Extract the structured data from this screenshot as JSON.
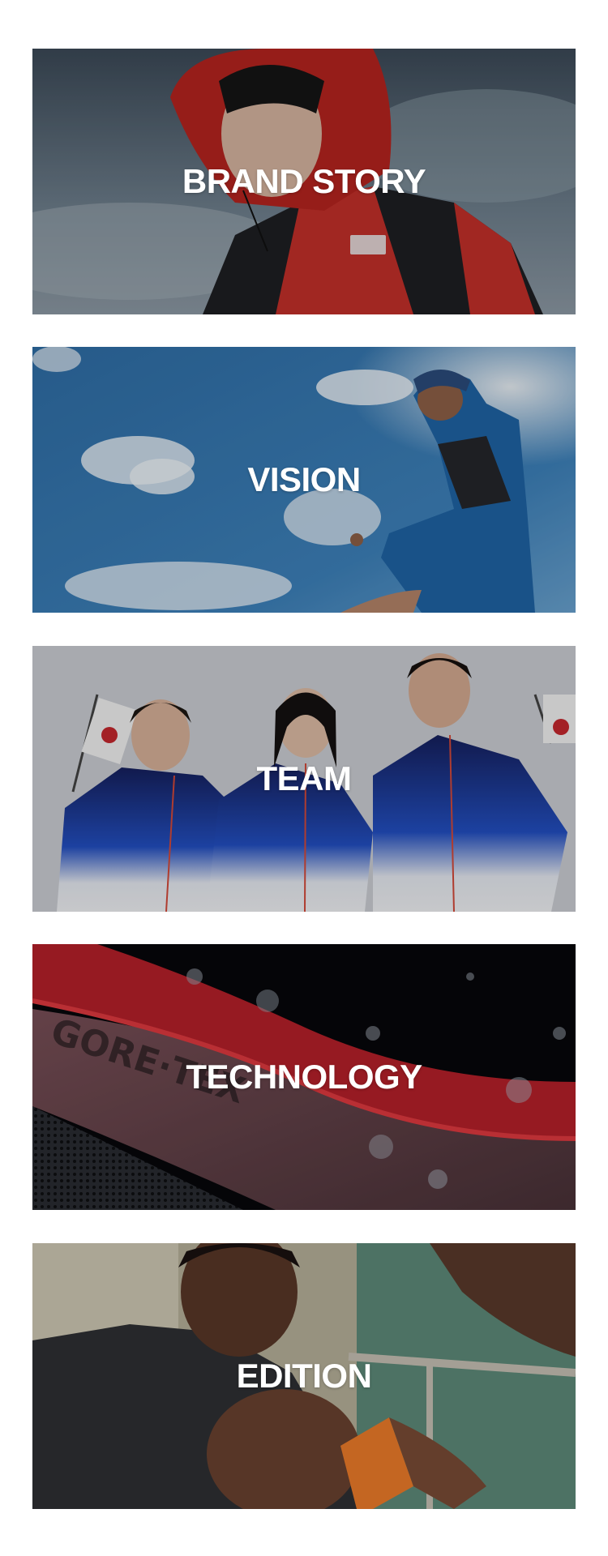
{
  "menu": {
    "items": [
      {
        "label": "BRAND STORY",
        "image": "model-in-red-hooded-jacket-photo"
      },
      {
        "label": "VISION",
        "image": "runner-jumping-against-sky-photo"
      },
      {
        "label": "TEAM",
        "image": "athletes-holding-korean-flags-photo"
      },
      {
        "label": "TECHNOLOGY",
        "image": "gore-tex-fabric-with-water-droplets-photo"
      },
      {
        "label": "EDITION",
        "image": "mother-feeding-baby-photo"
      }
    ]
  }
}
